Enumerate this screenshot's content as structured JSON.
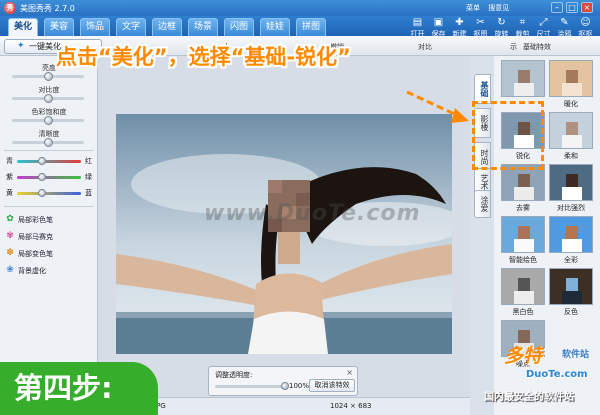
{
  "window": {
    "title": "美图秀秀 2.7.0",
    "top_links": [
      "菜单",
      "搜意见"
    ],
    "controls": [
      "–",
      "□",
      "×"
    ]
  },
  "tabs": [
    {
      "label": "美化",
      "active": true
    },
    {
      "label": "美容",
      "active": false
    },
    {
      "label": "饰品",
      "active": false
    },
    {
      "label": "文字",
      "active": false
    },
    {
      "label": "边框",
      "active": false
    },
    {
      "label": "场景",
      "active": false
    },
    {
      "label": "闪图",
      "active": false
    },
    {
      "label": "娃娃",
      "active": false
    },
    {
      "label": "拼图",
      "active": false
    }
  ],
  "toolbar": [
    {
      "label": "打开",
      "icon": "folder-icon"
    },
    {
      "label": "保存",
      "icon": "save-icon"
    },
    {
      "label": "新建",
      "icon": "new-icon"
    },
    {
      "label": "抠图",
      "icon": "cutout-icon"
    },
    {
      "label": "旋转",
      "icon": "rotate-icon"
    },
    {
      "label": "裁剪",
      "icon": "crop-icon"
    },
    {
      "label": "尺寸",
      "icon": "resize-icon"
    },
    {
      "label": "涂鸦",
      "icon": "brush-icon"
    },
    {
      "label": "抠抠",
      "icon": "chat-icon"
    }
  ],
  "subbar": {
    "restore_label": "一键美化",
    "zoom_label": "大",
    "labels": [
      "撤销",
      "对比",
      "示",
      "基础特效"
    ]
  },
  "left_panel": {
    "sliders": [
      {
        "label": "亮度",
        "value": 50
      },
      {
        "label": "对比度",
        "value": 50
      },
      {
        "label": "色彩饱和度",
        "value": 50
      },
      {
        "label": "清晰度",
        "value": 50
      }
    ],
    "color_sliders": [
      {
        "left": "青",
        "right": "红"
      },
      {
        "left": "紫",
        "right": "绿"
      },
      {
        "left": "黄",
        "right": "蓝"
      }
    ],
    "brushes": [
      {
        "label": "局部彩色笔",
        "icon": "color-pen-icon"
      },
      {
        "label": "局部马赛克",
        "icon": "mosaic-icon"
      },
      {
        "label": "局部变色笔",
        "icon": "recolor-pen-icon"
      },
      {
        "label": "背景虚化",
        "icon": "blur-icon"
      }
    ]
  },
  "canvas": {
    "watermark": "www.DuoTe.com",
    "transparency_title": "调整透明度:",
    "transparency_value": "100%",
    "transparency_fraction": 1.0,
    "cancel_label": "取消该特效",
    "status_dims": "1024 × 683",
    "status_format": "JPG"
  },
  "vertical_tabs": [
    {
      "label": "基础",
      "active": true
    },
    {
      "label": "影楼",
      "active": false
    },
    {
      "label": "时尚",
      "active": false
    },
    {
      "label": "艺术",
      "active": false
    },
    {
      "label": "涂爱",
      "active": false
    }
  ],
  "effects": [
    {
      "label": "",
      "tone": "normal"
    },
    {
      "label": "暖化",
      "tone": "warm"
    },
    {
      "label": "锐化",
      "tone": "sharp"
    },
    {
      "label": "柔和",
      "tone": "soft"
    },
    {
      "label": "去雾",
      "tone": "dehaze"
    },
    {
      "label": "对比强烈",
      "tone": "contrast"
    },
    {
      "label": "智能绘色",
      "tone": "smart"
    },
    {
      "label": "全彩",
      "tone": "vivid"
    },
    {
      "label": "黑白色",
      "tone": "mono"
    },
    {
      "label": "反色",
      "tone": "invert"
    },
    {
      "label": "噪点",
      "tone": "noise"
    }
  ],
  "annotation": {
    "instruction": "点击“美化”，选择“基础-锐化”",
    "step": "第四步:",
    "accent": "#ff8a00",
    "step_color": "#36ad2b"
  },
  "site_logo": {
    "brand": "多特",
    "sub": "软件站",
    "domain": "DuoTe.com",
    "slogan": "国内最安全的软件站"
  }
}
